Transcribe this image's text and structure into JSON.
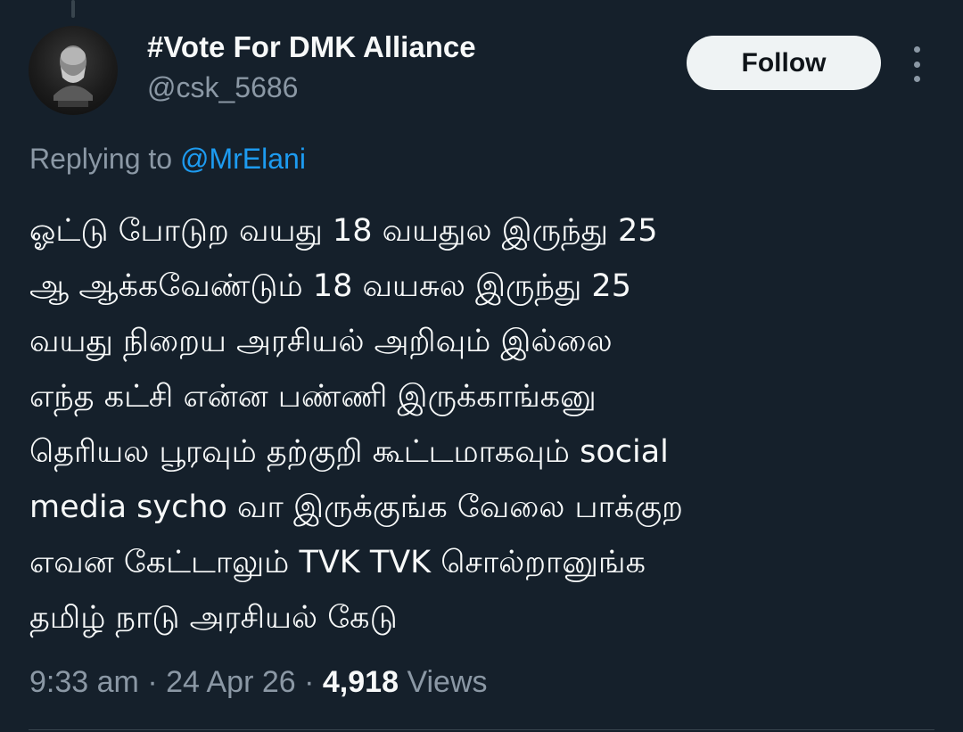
{
  "author": {
    "display_name": "#Vote For DMK Alliance",
    "handle": "@csk_5686",
    "avatar_icon": "bust-statue-avatar-icon"
  },
  "actions": {
    "follow_label": "Follow",
    "more_icon": "more-vertical-icon"
  },
  "reply": {
    "prefix": "Replying to",
    "mention": "@MrElani"
  },
  "tweet": {
    "lines": [
      "ஓட்டு போடுற வயது 18 வயதுல இருந்து 25",
      "ஆ ஆக்கவேண்டும் 18 வயசுல இருந்து 25",
      "வயது நிறைய அரசியல் அறிவும் இல்லை",
      "எந்த கட்சி என்ன பண்ணி இருக்காங்கனு",
      "தெரியல பூரவும் தற்குறி கூட்டமாகவும் social",
      "media sycho வா இருக்குங்க வேலை பாக்குற",
      "எவன கேட்டாலும் TVK TVK சொல்றானுங்க",
      "தமிழ் நாடு அரசியல் கேடு"
    ]
  },
  "meta": {
    "time": "9:33 am",
    "separator": "·",
    "date": "24 Apr 26",
    "views_count": "4,918",
    "views_label": "Views"
  },
  "colors": {
    "background": "#15202b",
    "text_primary": "#f7f9f9",
    "text_secondary": "#8b98a5",
    "link": "#1d9bf0",
    "follow_button_bg": "#eff3f4"
  }
}
